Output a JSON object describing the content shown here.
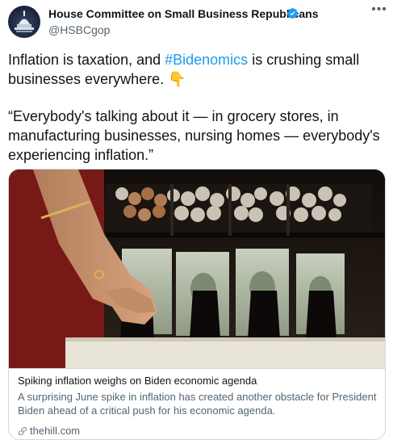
{
  "author": {
    "name": "House Committee on Small Business Republicans",
    "handle": "@HSBCgop",
    "verified": true
  },
  "tweet": {
    "text_before": "Inflation is taxation, and ",
    "hashtag": "#Bidenomics",
    "text_after": " is crushing small businesses everywhere. ",
    "emoji": "👇",
    "quote": "“Everybody's talking about it — in grocery stores, in manufacturing businesses, nursing homes — everybody's experiencing inflation.”"
  },
  "card": {
    "title": "Spiking inflation weighs on Biden economic agenda",
    "description": "A surprising June spike in inflation has created another obstacle for President Biden ahead of a critical push for his economic agenda.",
    "domain": "thehill.com",
    "image_icon": "cash-register-drawer-image"
  },
  "colors": {
    "accent": "#1d9bf0",
    "text": "#0f1419",
    "secondary": "#536471",
    "border": "#cfd9de"
  }
}
